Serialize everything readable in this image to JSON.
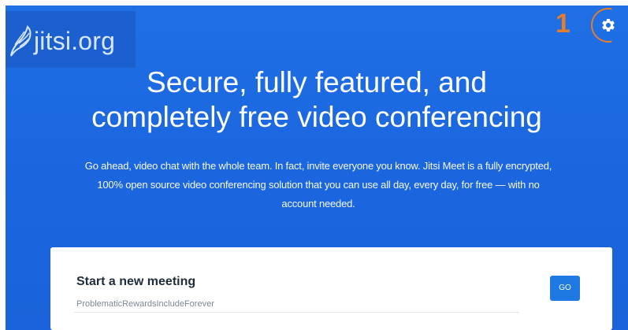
{
  "header": {
    "logo_text": "jitsi.org",
    "annotation_number": "1",
    "settings_icon": "gear-icon"
  },
  "hero": {
    "headline": "Secure, fully featured, and\ncompletely free video conferencing",
    "description": "Go ahead, video chat with the whole team. In fact, invite everyone you know. Jitsi Meet is a fully encrypted, 100% open source video conferencing solution that you can use all day, every day, for free — with no account needed."
  },
  "meeting": {
    "title": "Start a new meeting",
    "room_name_value": "ProblematicRewardsIncludeForever",
    "go_label": "GO"
  },
  "colors": {
    "hero_background": "#1f6fe5",
    "annotation": "#e67c2d",
    "go_button": "#1f79e2",
    "card_background": "#ffffff"
  }
}
